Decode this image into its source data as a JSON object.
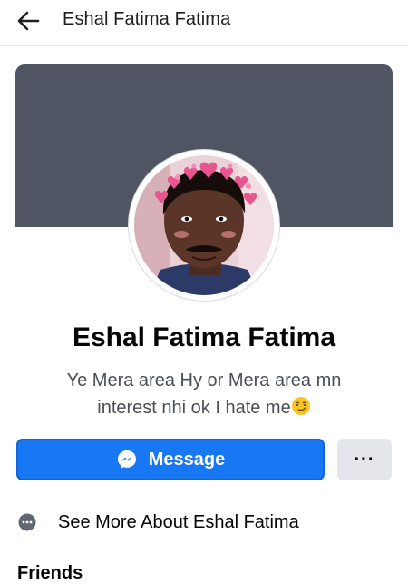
{
  "header": {
    "back_icon": "arrow-left-icon",
    "title": "Eshal Fatima Fatima"
  },
  "profile": {
    "name": "Eshal Fatima Fatima",
    "bio_line1": "Ye Mera area Hy or Mera area mn",
    "bio_line2": "interest nhi ok I hate me",
    "bio_emoji": "smirking-face-emoji",
    "cover_color": "#4f5562"
  },
  "actions": {
    "message_label": "Message",
    "message_icon": "messenger-icon",
    "more_label": "···",
    "accent_color": "#1877f2"
  },
  "about": {
    "see_more_label": "See More About Eshal Fatima",
    "icon": "more-dots-circle-icon"
  },
  "sections": {
    "friends_title": "Friends"
  }
}
